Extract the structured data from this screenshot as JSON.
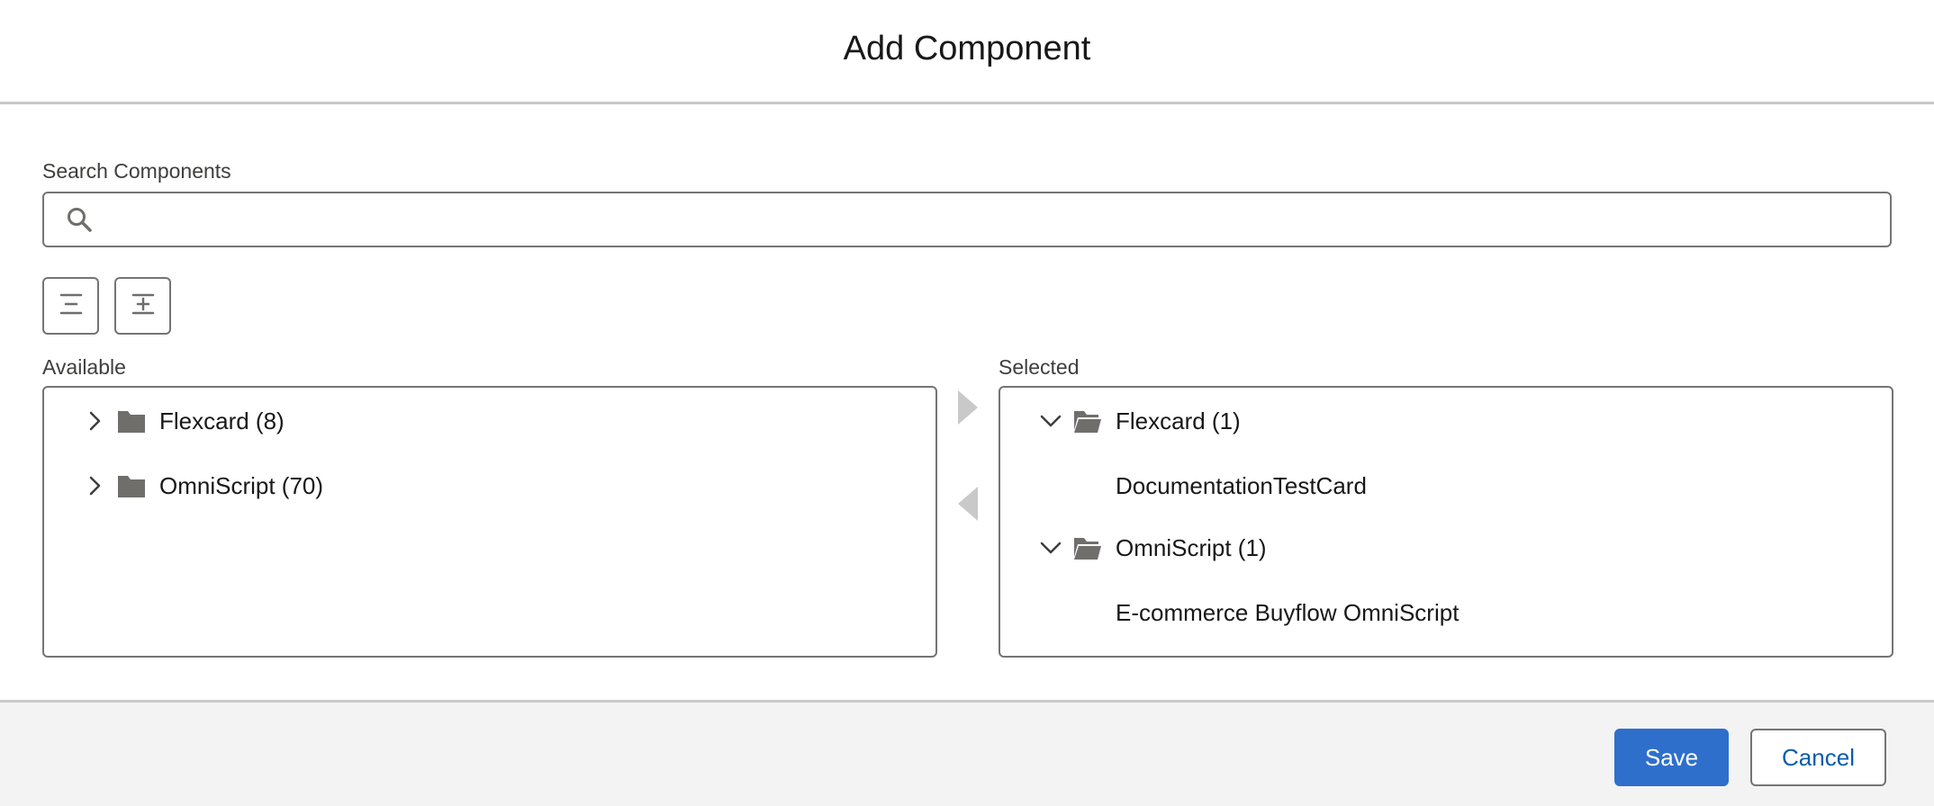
{
  "modal": {
    "title": "Add Component"
  },
  "search": {
    "label": "Search Components",
    "value": "",
    "placeholder": "",
    "icon": "search-icon"
  },
  "toolbar": {
    "collapse_all_icon": "collapse-all-icon",
    "expand_all_icon": "expand-all-icon"
  },
  "available": {
    "label": "Available",
    "items": [
      {
        "label": "Flexcard (8)",
        "expanded": false
      },
      {
        "label": "OmniScript (70)",
        "expanded": false
      }
    ]
  },
  "selected": {
    "label": "Selected",
    "groups": [
      {
        "label": "Flexcard (1)",
        "expanded": true,
        "children": [
          "DocumentationTestCard"
        ]
      },
      {
        "label": "OmniScript (1)",
        "expanded": true,
        "children": [
          "E-commerce Buyflow OmniScript"
        ]
      }
    ]
  },
  "move": {
    "to_selected_icon": "move-right-icon",
    "to_available_icon": "move-left-icon"
  },
  "footer": {
    "save_label": "Save",
    "cancel_label": "Cancel"
  },
  "colors": {
    "brand": "#2e6fcc",
    "link": "#0b5cab",
    "border": "#747474",
    "icon": "#706e6b",
    "footer_bg": "#f3f3f3"
  }
}
